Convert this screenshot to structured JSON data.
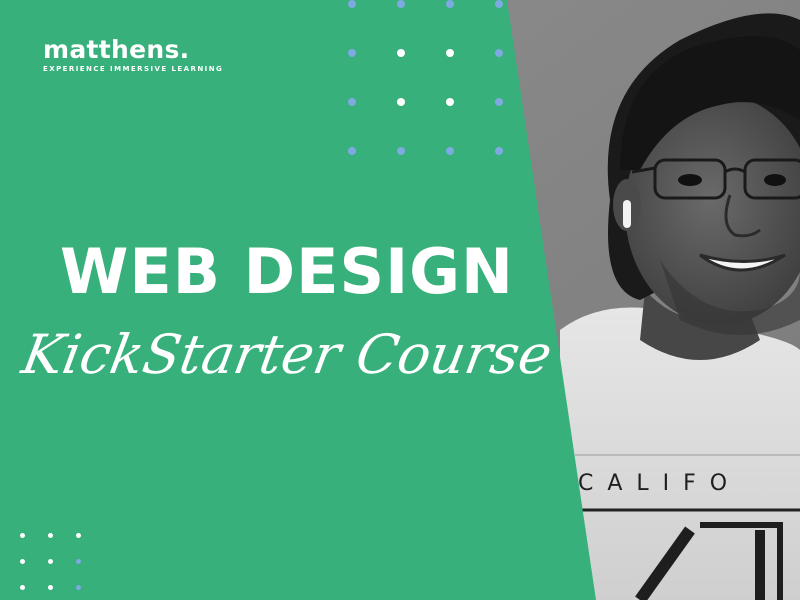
{
  "brand": {
    "name": "matthens.",
    "tagline": "EXPERIENCE IMMERSIVE LEARNING"
  },
  "headline": {
    "title": "WEB DESIGN",
    "subtitle": "KickStarter Course"
  },
  "photo": {
    "shirt_text": "CALIFO"
  },
  "colors": {
    "green": "#37b07b",
    "dot_blue": "#7ea9e1",
    "dot_white": "#ffffff",
    "text": "#ffffff"
  },
  "icons": [
    "dot-grid-pattern",
    "person-photo"
  ]
}
